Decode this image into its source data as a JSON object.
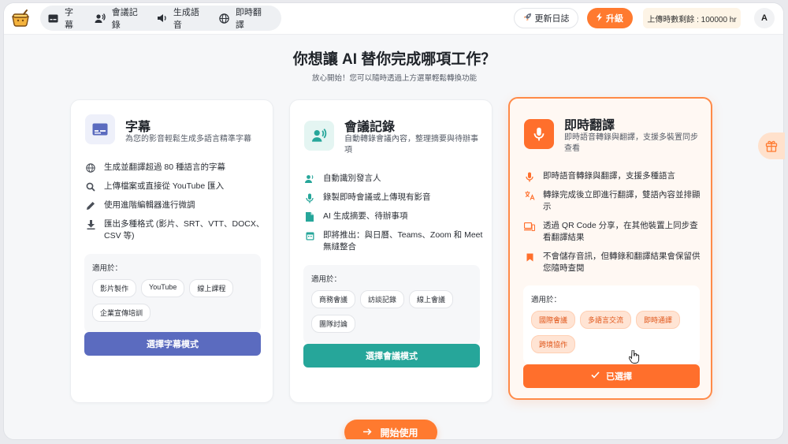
{
  "nav": {
    "items": [
      {
        "label": "字幕",
        "icon": "subtitles-icon"
      },
      {
        "label": "會議記錄",
        "icon": "meeting-icon"
      },
      {
        "label": "生成語音",
        "icon": "speaker-icon"
      },
      {
        "label": "即時翻譯",
        "icon": "globe-icon"
      }
    ],
    "update_label": "更新日誌",
    "upgrade_label": "升級",
    "quota_text": "上傳時數剩餘 : 100000 hr",
    "avatar_initial": "A"
  },
  "header": {
    "title": "你想讓 AI 替你完成哪項工作？",
    "subtitle": "放心開始！您可以隨時透過上方選單輕鬆轉換功能"
  },
  "cards": [
    {
      "title": "字幕",
      "desc": "為您的影音輕鬆生成多語言精準字幕",
      "icon": "subtitles-icon",
      "accent": "#5b6bbf",
      "features": [
        {
          "icon": "globe-icon",
          "text": "生成並翻譯超過 80 種語言的字幕"
        },
        {
          "icon": "search-icon",
          "text": "上傳檔案或直接從 YouTube 匯入"
        },
        {
          "icon": "pencil-icon",
          "text": "使用進階編輯器進行微調"
        },
        {
          "icon": "download-icon",
          "text": "匯出多種格式 (影片、SRT、VTT、DOCX、CSV 等)"
        }
      ],
      "usage_label": "適用於：",
      "tags": [
        "影片製作",
        "YouTube",
        "線上課程",
        "企業宣傳培訓"
      ],
      "button_label": "選擇字幕模式"
    },
    {
      "title": "會議記錄",
      "desc": "自動轉錄會議內容，整理摘要與待辦事項",
      "icon": "meeting-icon",
      "accent": "#26a69a",
      "features": [
        {
          "icon": "speaker-id-icon",
          "text": "自動識別發言人"
        },
        {
          "icon": "mic-icon",
          "text": "錄製即時會議或上傳現有影音"
        },
        {
          "icon": "document-icon",
          "text": "AI 生成摘要、待辦事項"
        },
        {
          "icon": "calendar-icon",
          "text": "即將推出：與日曆、Teams、Zoom 和 Meet 無縫整合"
        }
      ],
      "usage_label": "適用於：",
      "tags": [
        "商務會議",
        "訪談記錄",
        "線上會議",
        "團隊討論"
      ],
      "button_label": "選擇會議模式"
    },
    {
      "title": "即時翻譯",
      "desc": "即時語音轉錄與翻譯，支援多裝置同步查看",
      "icon": "mic-icon",
      "accent": "#ff6f2c",
      "features": [
        {
          "icon": "mic-icon",
          "text": "即時語音轉錄與翻譯，支援多種語言"
        },
        {
          "icon": "translate-icon",
          "text": "轉錄完成後立即進行翻譯，雙語內容並排顯示"
        },
        {
          "icon": "devices-icon",
          "text": "透過 QR Code 分享，在其他裝置上同步查看翻譯結果"
        },
        {
          "icon": "bookmark-icon",
          "text": "不會儲存音訊，但轉錄和翻譯結果會保留供您隨時查閱"
        }
      ],
      "usage_label": "適用於：",
      "tags": [
        "國際會議",
        "多語言交流",
        "即時通譯",
        "跨境協作"
      ],
      "button_label": "已選擇"
    }
  ],
  "start_label": "開始使用",
  "colors": {
    "brand_orange": "#ff7a2f",
    "indigo": "#5b6bbf",
    "teal": "#26a69a"
  }
}
